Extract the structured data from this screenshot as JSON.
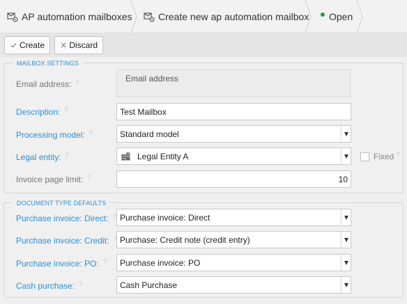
{
  "breadcrumbs": [
    {
      "label": "AP automation mailboxes",
      "icon": "mailbox-settings-icon"
    },
    {
      "label": "Create new ap automation mailbox",
      "icon": "mailbox-settings-icon"
    },
    {
      "label": "Open",
      "status_color": "#2e9b3a"
    }
  ],
  "toolbar": {
    "create_label": "Create",
    "discard_label": "Discard"
  },
  "mailbox_settings": {
    "legend": "MAILBOX SETTINGS",
    "email": {
      "label": "Email address:",
      "placeholder": "Email address"
    },
    "description": {
      "label": "Description:",
      "value": "Test Mailbox"
    },
    "processing_model": {
      "label": "Processing model:",
      "value": "Standard model"
    },
    "legal_entity": {
      "label": "Legal entity:",
      "value": "Legal Entity A",
      "fixed_label": "Fixed"
    },
    "invoice_page_limit": {
      "label": "Invoice page limit:",
      "value": "10"
    }
  },
  "document_type_defaults": {
    "legend": "DOCUMENT TYPE DEFAULTS",
    "direct": {
      "label": "Purchase invoice: Direct:",
      "value": "Purchase invoice: Direct"
    },
    "credit": {
      "label": "Purchase invoice: Credit:",
      "value": "Purchase: Credit note (credit entry)"
    },
    "po": {
      "label": "Purchase invoice: PO:",
      "value": "Purchase invoice: PO"
    },
    "cash": {
      "label": "Cash purchase:",
      "value": "Cash Purchase"
    }
  },
  "help_marker": "?",
  "colors": {
    "accent": "#2a8fd4",
    "status_open": "#2e9b3a"
  }
}
